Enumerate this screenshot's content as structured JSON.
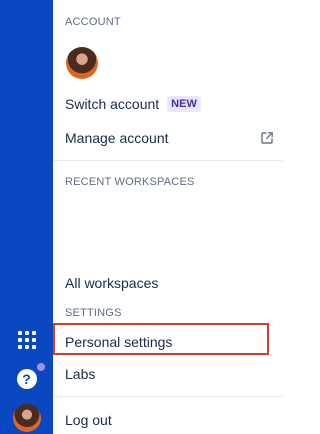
{
  "account": {
    "section_title": "ACCOUNT",
    "switch_account": "Switch account",
    "new_badge": "NEW",
    "manage_account": "Manage account"
  },
  "recent": {
    "section_title": "RECENT WORKSPACES",
    "all_workspaces": "All workspaces"
  },
  "settings": {
    "section_title": "SETTINGS",
    "personal_settings": "Personal settings",
    "labs": "Labs"
  },
  "logout": "Log out",
  "sidebar": {
    "help_glyph": "?"
  },
  "colors": {
    "sidebar": "#0c47c2",
    "highlight": "#e03a25",
    "badge_bg": "#eae6ff",
    "badge_text": "#403294"
  }
}
